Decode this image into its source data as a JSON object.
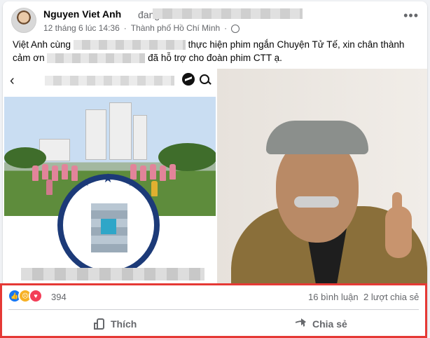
{
  "post": {
    "author": "Nguyen Viet Anh",
    "at_text": "đang ở",
    "date": "12 tháng 6 lúc 14:36",
    "separator": "·",
    "location": "Thành phố Hồ Chí Minh",
    "separator2": "·",
    "more": "•••",
    "text_part1": "Việt Anh cùng ",
    "text_part2": " thực hiện phim ngắn Chuyện Tử Tế, xin chân thành cảm ơn ",
    "text_part3": " đã hỗ trợ cho đoàn phim CTT ạ."
  },
  "left_image": {
    "back": "‹"
  },
  "reactions": {
    "count": "394",
    "comments": "16 bình luận",
    "shares": "2 lượt chia sẻ",
    "like_label": "Thích",
    "share_label": "Chia sẻ"
  },
  "colors": {
    "accent": "#1877f2",
    "highlight_border": "#e53935"
  }
}
